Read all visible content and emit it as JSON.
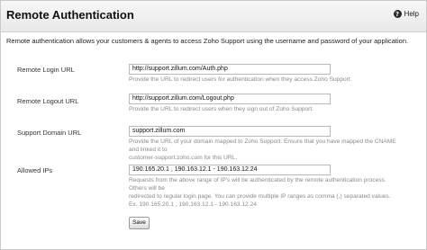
{
  "header": {
    "title": "Remote Authentication",
    "help_label": "Help",
    "help_icon_glyph": "?"
  },
  "intro": "Remote authentication allows your customers & agents to access Zoho Support using the username and password of your application.",
  "fields": [
    {
      "label": "Remote Login URL",
      "value": "http://support.zillum.com/Auth.php",
      "hint": "Provide the URL to redirect users for authentication when they access Zoho Support."
    },
    {
      "label": "Remote Logout URL",
      "value": "http://support.zillum.com/Logout.php",
      "hint": "Provide the URL to redirect users when they sign out of Zoho Support."
    },
    {
      "label": "Support Domain URL",
      "value": "support.zillum.com",
      "hint_lines": [
        "Provide the URL of your domain mapped to Zoho Support. Ensure that you have mapped the CNAME and linked it to",
        "customer-support.zoho.com for this URL."
      ]
    },
    {
      "label": "Allowed IPs",
      "value": "190.165.20.1 , 190.163.12.1 - 190.163.12.24",
      "hint_lines": [
        "Requests from the above range of IP's will be authenticated by the remote authentication process. Others will be",
        "redirected to regular login page. You can provide multiple IP ranges as comma (,) separated values.",
        "Ex. 190.165.20.1 , 190.163.12.1 - 190.163.12.24"
      ]
    }
  ],
  "save_label": "Save"
}
